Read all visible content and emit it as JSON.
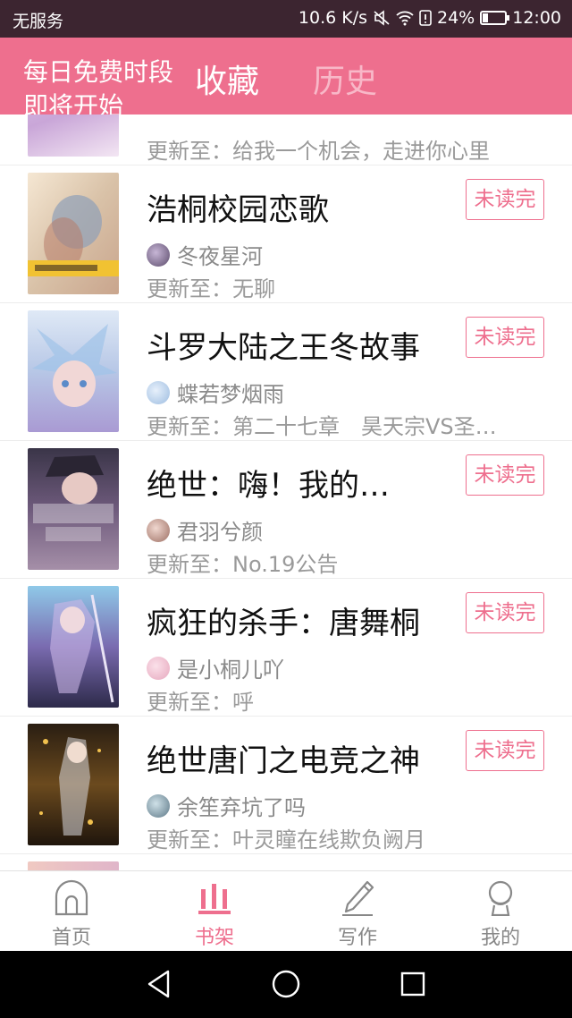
{
  "status_bar": {
    "carrier": "无服务",
    "speed": "10.6 K/s",
    "battery": "24%",
    "battery_level": 0.24,
    "time": "12:00"
  },
  "header": {
    "banner": "每日免费时段 即将开始",
    "tabs": [
      {
        "label": "收藏",
        "active": true
      },
      {
        "label": "历史",
        "active": false
      }
    ],
    "accent_color": "#ee6f8e"
  },
  "list": {
    "partial_top": {
      "update": "更新至：给我一个机会，走进你心里"
    },
    "items": [
      {
        "title": "浩桐校园恋歌",
        "author": "冬夜星河",
        "update": "更新至：无聊",
        "badge": "未读完"
      },
      {
        "title": "斗罗大陆之王冬故事",
        "author": "蝶若梦烟雨",
        "update": "更新至：第二十七章　昊天宗VS圣…",
        "badge": "未读完"
      },
      {
        "title": "绝世：嗨！我的…",
        "author": "君羽兮颜",
        "update": "更新至：No.19公告",
        "badge": "未读完"
      },
      {
        "title": "疯狂的杀手：唐舞桐",
        "author": "是小桐儿吖",
        "update": "更新至：呼",
        "badge": "未读完"
      },
      {
        "title": "绝世唐门之电竞之神",
        "author": "余笙弃坑了吗",
        "update": "更新至：叶灵瞳在线欺负阙月",
        "badge": "未读完"
      }
    ]
  },
  "tabbar": {
    "items": [
      {
        "label": "首页",
        "icon": "home-icon"
      },
      {
        "label": "书架",
        "icon": "bookshelf-icon",
        "active": true
      },
      {
        "label": "写作",
        "icon": "pen-icon"
      },
      {
        "label": "我的",
        "icon": "profile-icon"
      }
    ]
  },
  "navbar": {
    "icons": [
      "back-icon",
      "home-circle-icon",
      "recents-icon"
    ]
  }
}
